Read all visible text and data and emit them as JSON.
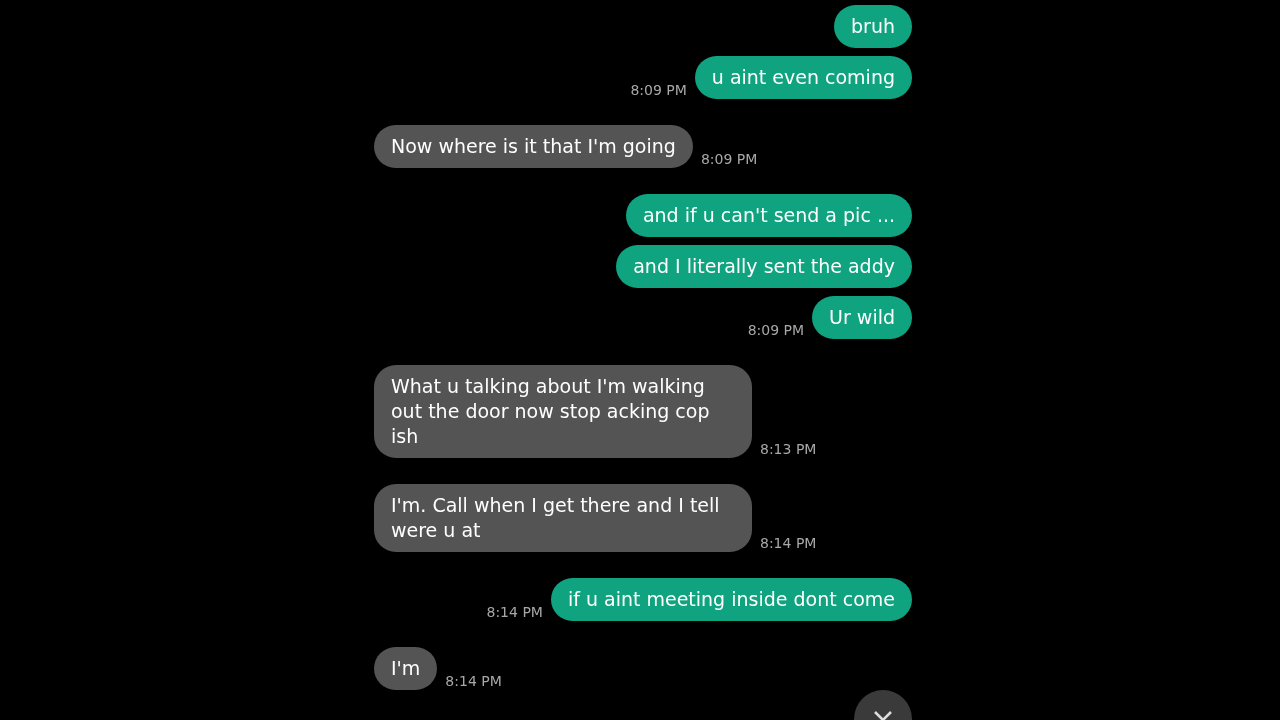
{
  "messages": [
    {
      "kind": "outgoing",
      "text": "bruh"
    },
    {
      "kind": "outgoing",
      "text": "u aint even coming",
      "time": "8:09 PM"
    },
    {
      "kind": "incoming",
      "text": "Now where is it that I'm going",
      "time": "8:09 PM"
    },
    {
      "kind": "outgoing",
      "text": "and if u can't send a pic ..."
    },
    {
      "kind": "outgoing",
      "text": "and I literally sent the addy"
    },
    {
      "kind": "outgoing",
      "text": "Ur wild",
      "time": "8:09 PM"
    },
    {
      "kind": "incoming",
      "text": "What u talking about I'm walking out the door now stop acking cop ish",
      "time": "8:13 PM"
    },
    {
      "kind": "incoming",
      "text": "I'm. Call when I get there and I tell were u at",
      "time": "8:14 PM"
    },
    {
      "kind": "outgoing",
      "text": "if u aint meeting inside dont come",
      "time": "8:14 PM"
    },
    {
      "kind": "incoming",
      "text": "I'm",
      "time": "8:14 PM"
    }
  ]
}
